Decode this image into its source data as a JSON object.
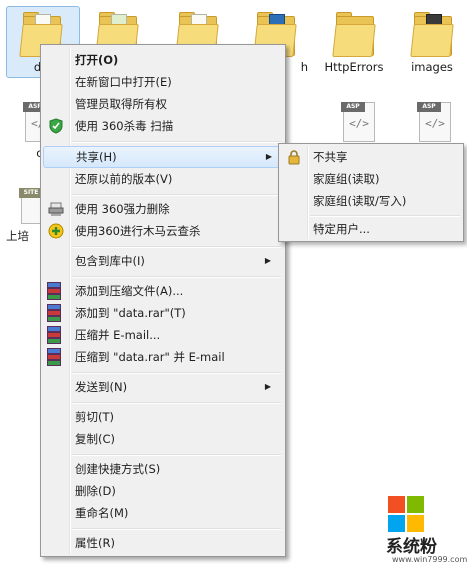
{
  "files": [
    {
      "label": "da",
      "type": "folder"
    },
    {
      "label": "",
      "type": "folder"
    },
    {
      "label": "",
      "type": "folder"
    },
    {
      "label": "h",
      "type": "folder"
    },
    {
      "label": "HttpErrors",
      "type": "folder"
    },
    {
      "label": "images",
      "type": "folder"
    },
    {
      "label": "cl",
      "type": "asp"
    },
    {
      "label": "",
      "type": "asp"
    },
    {
      "label": "",
      "type": "asp"
    },
    {
      "label": "上培",
      "type": "site"
    }
  ],
  "file_tag_asp": "ASP",
  "file_tag_site": "SITE",
  "menu": {
    "open": "打开(O)",
    "open_new_window": "在新窗口中打开(E)",
    "admin_ownership": "管理员取得所有权",
    "scan_360": "使用 360杀毒 扫描",
    "share": "共享(H)",
    "restore_previous": "还原以前的版本(V)",
    "force_delete_360": "使用 360强力删除",
    "trojan_scan_360": "使用360进行木马云查杀",
    "include_in_library": "包含到库中(I)",
    "add_to_archive": "添加到压缩文件(A)...",
    "add_to_data_rar": "添加到 \"data.rar\"(T)",
    "compress_email": "压缩并 E-mail...",
    "compress_data_rar_email": "压缩到 \"data.rar\" 并 E-mail",
    "send_to": "发送到(N)",
    "cut": "剪切(T)",
    "copy": "复制(C)",
    "create_shortcut": "创建快捷方式(S)",
    "delete": "删除(D)",
    "rename": "重命名(M)",
    "properties": "属性(R)"
  },
  "submenu": {
    "no_share": "不共享",
    "homegroup_read": "家庭组(读取)",
    "homegroup_read_write": "家庭组(读取/写入)",
    "specific_users": "特定用户..."
  },
  "watermark": {
    "title": "系统粉",
    "url": "www.win7999.com"
  },
  "colors": {
    "highlight": "#d6e8fb",
    "menu_bg": "#f0f0f0",
    "logo_red": "#f25022",
    "logo_green": "#7fba00",
    "logo_blue": "#00a4ef",
    "logo_yellow": "#ffb900"
  }
}
